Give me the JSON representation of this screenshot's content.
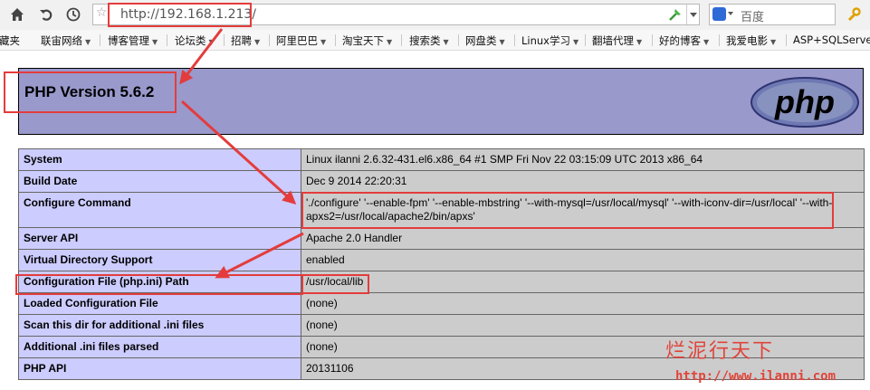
{
  "browser": {
    "address": {
      "url": "http://192.168.1.213/"
    },
    "search": {
      "placeholder": "百度"
    },
    "favorites": [
      {
        "label": "藏夹",
        "dropdown": false
      },
      {
        "label": "联宙网络",
        "dropdown": true
      },
      {
        "label": "博客管理",
        "dropdown": true
      },
      {
        "label": "论坛类",
        "dropdown": true
      },
      {
        "label": "招聘",
        "dropdown": true
      },
      {
        "label": "阿里巴巴",
        "dropdown": true
      },
      {
        "label": "淘宝天下",
        "dropdown": true
      },
      {
        "label": "搜索类",
        "dropdown": true
      },
      {
        "label": "网盘类",
        "dropdown": true
      },
      {
        "label": "Linux学习",
        "dropdown": true
      },
      {
        "label": "翻墙代理",
        "dropdown": true
      },
      {
        "label": "好的博客",
        "dropdown": true
      },
      {
        "label": "我爱电影",
        "dropdown": true
      },
      {
        "label": "ASP+SQLServer",
        "dropdown": false
      }
    ]
  },
  "php": {
    "title": "PHP Version 5.6.2",
    "logo_text": "php",
    "rows": [
      {
        "key": "System",
        "value": "Linux ilanni 2.6.32-431.el6.x86_64 #1 SMP Fri Nov 22 03:15:09 UTC 2013 x86_64"
      },
      {
        "key": "Build Date",
        "value": "Dec 9 2014 22:20:31"
      },
      {
        "key": "Configure Command",
        "value": "'./configure' '--enable-fpm' '--enable-mbstring' '--with-mysql=/usr/local/mysql' '--with-iconv-dir=/usr/local' '--with-apxs2=/usr/local/apache2/bin/apxs'"
      },
      {
        "key": "Server API",
        "value": "Apache 2.0 Handler"
      },
      {
        "key": "Virtual Directory Support",
        "value": "enabled"
      },
      {
        "key": "Configuration File (php.ini) Path",
        "value": "/usr/local/lib"
      },
      {
        "key": "Loaded Configuration File",
        "value": "(none)"
      },
      {
        "key": "Scan this dir for additional .ini files",
        "value": "(none)"
      },
      {
        "key": "Additional .ini files parsed",
        "value": "(none)"
      },
      {
        "key": "PHP API",
        "value": "20131106"
      }
    ]
  },
  "watermark": {
    "text": "烂泥行天下",
    "url": "http://www.ilanni.com"
  },
  "colors": {
    "annotation": "#e43c3c",
    "php_header": "#9999cc",
    "table_key": "#ccccff",
    "table_value": "#cccccc"
  }
}
